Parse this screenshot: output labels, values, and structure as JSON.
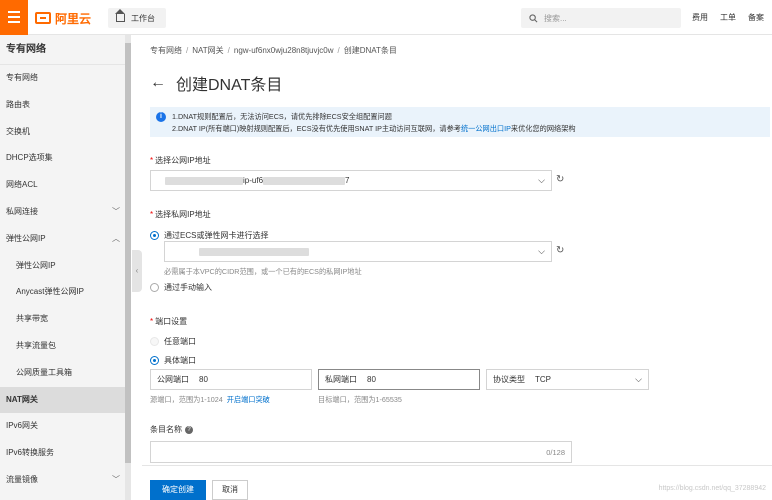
{
  "colors": {
    "brand": "#ff6a00",
    "primary": "#0070cc",
    "notice_bg": "#eaf3fb"
  },
  "topbar": {
    "logo_text": "阿里云",
    "workbench_label": "工作台",
    "search_placeholder": "搜索...",
    "links": [
      "费用",
      "工单",
      "备案"
    ]
  },
  "sidebar": {
    "title": "专有网络",
    "items": [
      {
        "label": "专有网络"
      },
      {
        "label": "路由表"
      },
      {
        "label": "交换机"
      },
      {
        "label": "DHCP选项集"
      },
      {
        "label": "网络ACL"
      },
      {
        "label": "私网连接",
        "chevron": "﹀"
      },
      {
        "label": "弹性公网IP",
        "chevron": "︿"
      },
      {
        "label": "弹性公网IP"
      },
      {
        "label": "Anycast弹性公网IP"
      },
      {
        "label": "共享带宽"
      },
      {
        "label": "共享流量包"
      },
      {
        "label": "公网质量工具箱"
      },
      {
        "label": "NAT网关"
      },
      {
        "label": "IPv6网关"
      },
      {
        "label": "IPv6转换服务"
      },
      {
        "label": "流量镜像",
        "chevron": "﹀"
      }
    ]
  },
  "breadcrumb": [
    "专有网络",
    "NAT网关",
    "ngw-uf6nx0wju28n8tjuvjc0w",
    "创建DNAT条目"
  ],
  "page_title": "创建DNAT条目",
  "notice": {
    "line1": "1.DNAT规则配置后，无法访问ECS，请优先排除ECS安全组配置问题",
    "line2_pre": "2.DNAT IP(所有端口)映射规则配置后，ECS没有优先使用SNAT IP主动访问互联网，请参考",
    "line2_link": "统一公网出口IP",
    "line2_post": "来优化您的网络架构"
  },
  "public_ip": {
    "label": "选择公网IP地址",
    "value_visible": "ip-uf6",
    "value_tail": "7"
  },
  "private_ip": {
    "label": "选择私网IP地址",
    "option_ecs": "通过ECS或弹性网卡进行选择",
    "hint": "必需属于本VPC的CIDR范围，或一个已有的ECS的私网IP地址",
    "option_manual": "通过手动输入"
  },
  "port": {
    "label": "端口设置",
    "option_any": "任意端口",
    "option_specific": "具体端口",
    "public_port_label": "公网端口",
    "public_port_value": "80",
    "private_port_label": "私网端口",
    "private_port_value": "80",
    "protocol_label": "协议类型",
    "protocol_value": "TCP",
    "public_hint": "源端口，范围为1-1024",
    "public_hint_link": "开启端口突破",
    "private_hint": "目标端口，范围为1-65535"
  },
  "entry_name": {
    "label": "条目名称",
    "counter": "0/128"
  },
  "footer": {
    "confirm": "确定创建",
    "cancel": "取消",
    "watermark": "https://blog.csdn.net/qq_37288942"
  },
  "icons": {
    "menu": "hamburger-icon",
    "home": "home-icon",
    "search": "search-icon",
    "back": "←",
    "info": "i",
    "refresh": "↻",
    "chevron_down": "⌵",
    "help": "?"
  }
}
